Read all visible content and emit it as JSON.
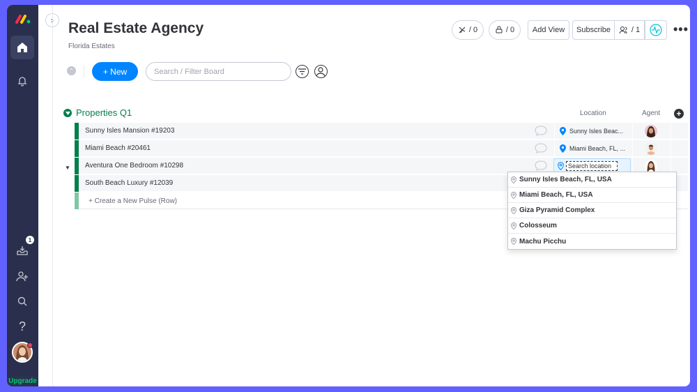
{
  "nav": {
    "upgrade_label": "Upgrade",
    "inbox_badge": "1"
  },
  "header": {
    "title": "Real Estate Agency",
    "subtitle": "Florida Estates",
    "automations_count": "/ 0",
    "integrations_count": "/ 0",
    "add_view_label": "Add View",
    "subscribe_label": "Subscribe",
    "people_count": "/ 1"
  },
  "toolbar": {
    "new_label": "+ New",
    "search_placeholder": "Search / Filter Board"
  },
  "group": {
    "title": "Properties Q1",
    "columns": {
      "location": "Location",
      "agent": "Agent"
    },
    "rows": [
      {
        "name": "Sunny Isles Mansion #19203",
        "location": "Sunny Isles Beac..."
      },
      {
        "name": "Miami Beach #20461",
        "location": "Miami Beach, FL, ..."
      },
      {
        "name": "Aventura One Bedroom #10298",
        "location": ""
      },
      {
        "name": "South Beach Luxury #12039",
        "location": ""
      }
    ],
    "create_label": "+ Create a New Pulse (Row)"
  },
  "location_editor": {
    "placeholder": "Search location"
  },
  "location_options": [
    "Sunny Isles Beach, FL, USA",
    "Miami Beach, FL, USA",
    "Giza Pyramid Complex",
    "Colosseum",
    "Machu Picchu"
  ],
  "colors": {
    "nav_bg": "#292f4c",
    "accent": "#0085ff",
    "group_green": "#037f4c",
    "frame": "#6161ff"
  }
}
